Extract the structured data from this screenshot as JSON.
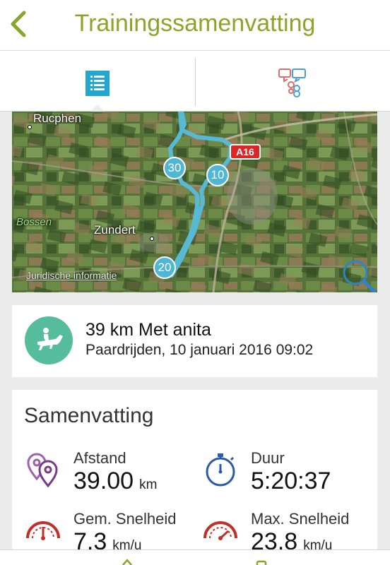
{
  "header": {
    "title": "Trainingssamenvatting",
    "back_icon": "chevron-left-icon",
    "accent": "#8aa62a"
  },
  "tabs": [
    {
      "icon": "list-icon",
      "selected": true,
      "color": "#22a7cf"
    },
    {
      "icon": "comments-icon",
      "selected": false,
      "color": "#e06a6a"
    }
  ],
  "map": {
    "places": [
      "Rucphen",
      "Bossen",
      "Zundert"
    ],
    "road_sign": "A16",
    "legal_link": "Juridische informatie",
    "km_markers": [
      "30",
      "10",
      "20"
    ],
    "route_color": "#58b9d4",
    "zoom_icon": "magnifier-icon"
  },
  "activity": {
    "icon": "horse-riding-icon",
    "icon_bg": "#56bd9c",
    "title": "39 km Met anita",
    "subtitle": "Paardrijden, 10 januari 2016 09:02"
  },
  "summary": {
    "title": "Samenvatting",
    "stats": [
      {
        "label": "Afstand",
        "value": "39.00",
        "unit": "km",
        "icon": "location-pins-icon"
      },
      {
        "label": "Duur",
        "value": "5:20:37",
        "unit": "",
        "icon": "stopwatch-icon"
      },
      {
        "label": "Gem. Snelheid",
        "value": "7.3",
        "unit": "km/u",
        "icon": "speedometer-icon"
      },
      {
        "label": "Max. Snelheid",
        "value": "23.8",
        "unit": "km/u",
        "icon": "speedometer-max-icon"
      }
    ]
  }
}
